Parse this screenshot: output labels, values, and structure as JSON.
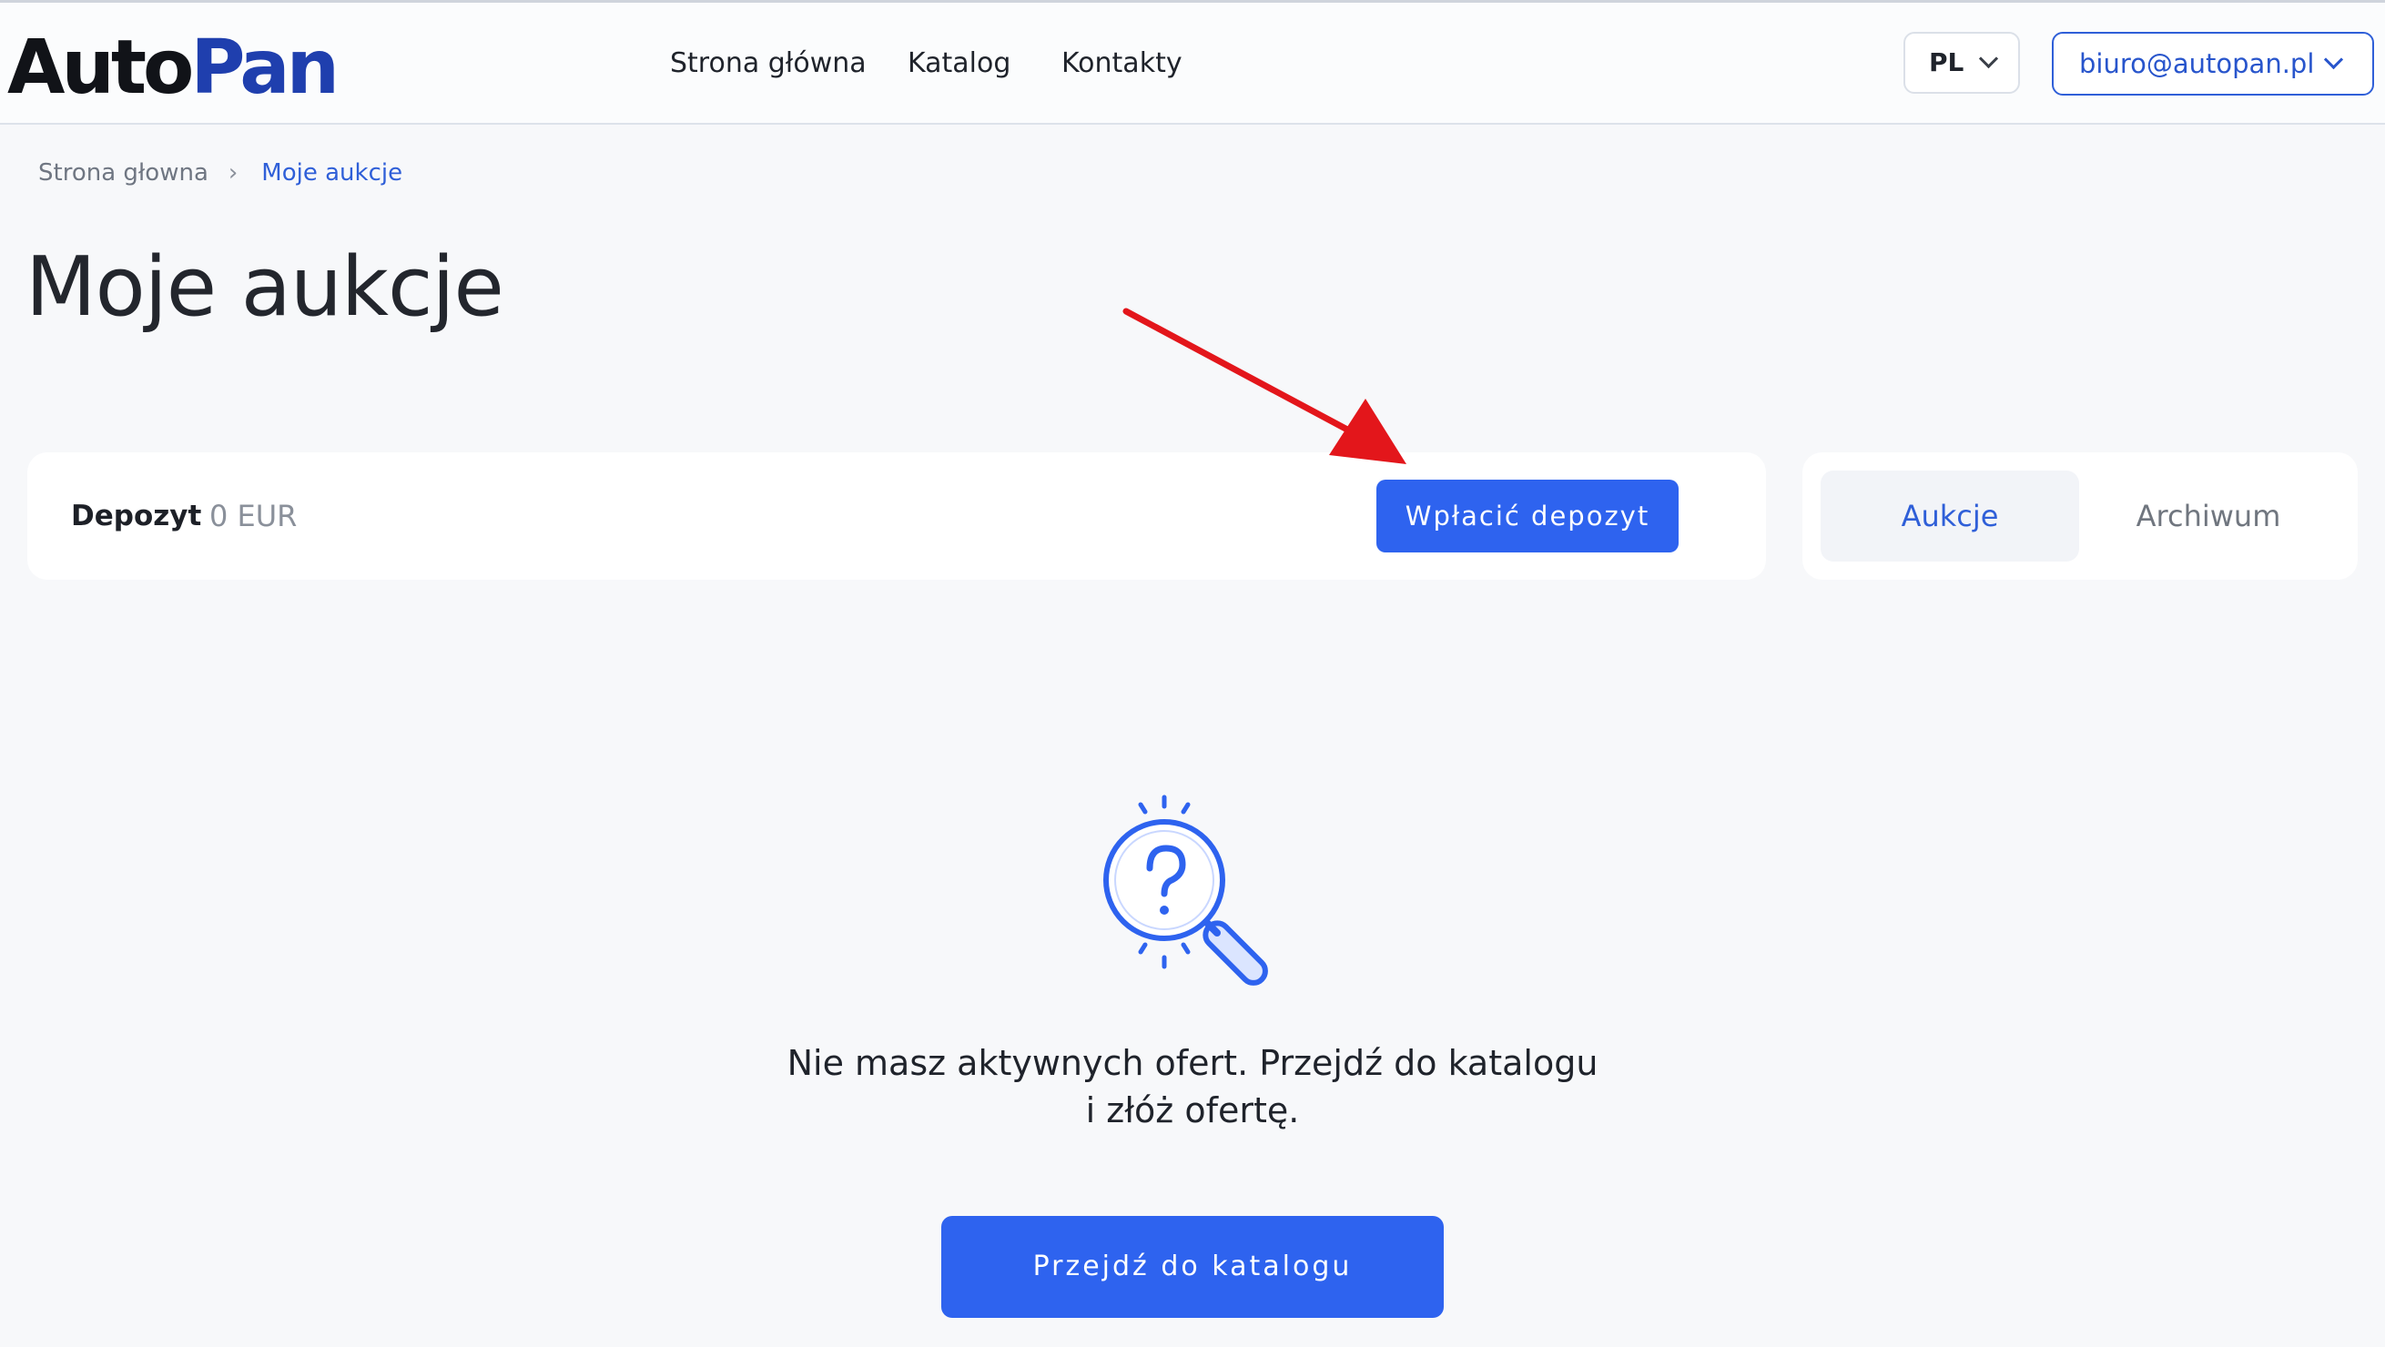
{
  "header": {
    "logo_part1": "Auto",
    "logo_part2": "Pan",
    "nav": [
      {
        "label": "Strona główna"
      },
      {
        "label": "Katalog"
      },
      {
        "label": "Kontakty"
      }
    ],
    "language": "PL",
    "account_email": "biuro@autopan.pl"
  },
  "breadcrumb": {
    "home": "Strona głowna",
    "separator": "›",
    "current": "Moje aukcje"
  },
  "page_title": "Moje aukcje",
  "deposit": {
    "label": "Depozyt",
    "value": "0 EUR",
    "button_label": "Wpłacić depozyt"
  },
  "tabs": [
    {
      "label": "Aukcje",
      "active": true
    },
    {
      "label": "Archiwum",
      "active": false
    }
  ],
  "empty_state": {
    "icon": "magnifier-question-icon",
    "message": "Nie masz aktywnych ofert. Przejdź do katalogu i złóż ofertę.",
    "button_label": "Przejdź do katalogu"
  },
  "colors": {
    "accent": "#2e63ef",
    "link": "#2f5fd8",
    "logo_dark": "#111318",
    "logo_blue": "#1f3fae",
    "annotation_arrow": "#e3161b",
    "background": "#f7f8fa"
  }
}
